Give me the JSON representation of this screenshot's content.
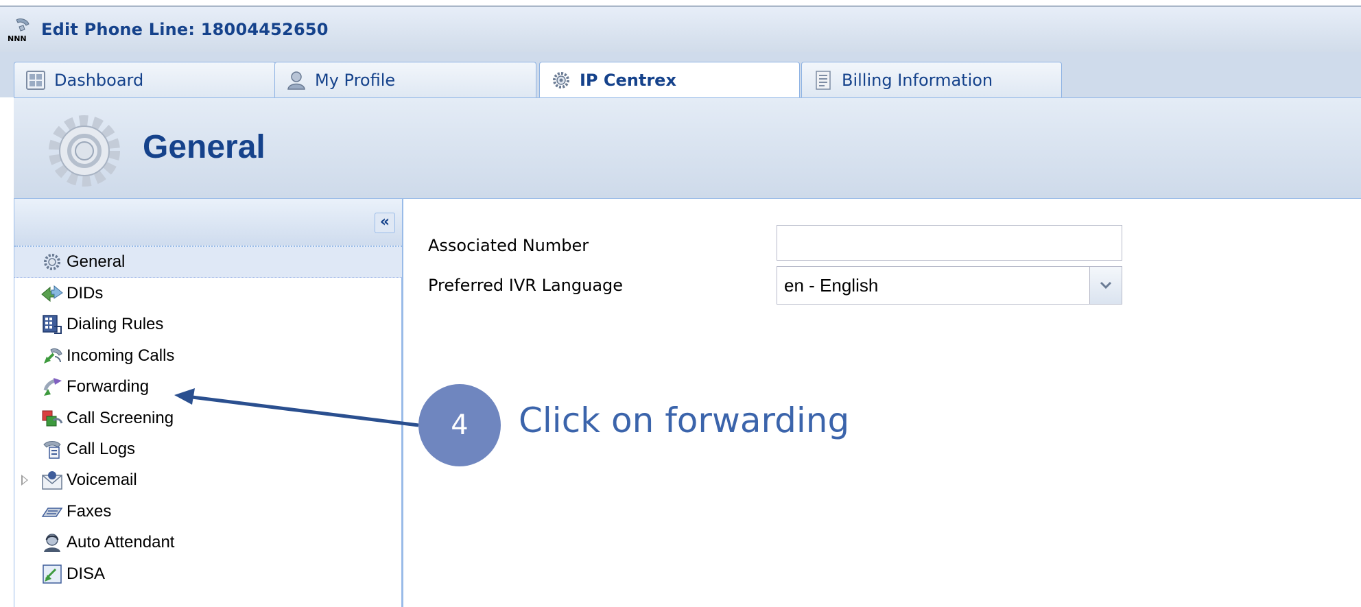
{
  "window": {
    "title": "Edit Phone Line: 18004452650",
    "icon": "phone-line-icon"
  },
  "tabs": [
    {
      "label": "Dashboard",
      "icon": "dashboard-icon",
      "active": false
    },
    {
      "label": "My Profile",
      "icon": "profile-icon",
      "active": false
    },
    {
      "label": "IP Centrex",
      "icon": "gear-icon",
      "active": true
    },
    {
      "label": "Billing Information",
      "icon": "billing-icon",
      "active": false
    }
  ],
  "header": {
    "title": "General",
    "icon": "gear-icon"
  },
  "sidebar": {
    "collapse_label": "«",
    "items": [
      {
        "label": "General",
        "icon": "gear-icon",
        "selected": true
      },
      {
        "label": "DIDs",
        "icon": "dids-icon"
      },
      {
        "label": "Dialing Rules",
        "icon": "dialpad-icon"
      },
      {
        "label": "Incoming Calls",
        "icon": "incoming-call-icon"
      },
      {
        "label": "Forwarding",
        "icon": "forward-icon"
      },
      {
        "label": "Call Screening",
        "icon": "screening-icon"
      },
      {
        "label": "Call Logs",
        "icon": "call-logs-icon"
      },
      {
        "label": "Voicemail",
        "icon": "voicemail-icon",
        "expandable": true
      },
      {
        "label": "Faxes",
        "icon": "fax-icon"
      },
      {
        "label": "Auto Attendant",
        "icon": "attendant-icon"
      },
      {
        "label": "DISA",
        "icon": "disa-icon"
      }
    ]
  },
  "form": {
    "associated_number_label": "Associated Number",
    "associated_number_value": "",
    "ivr_language_label": "Preferred IVR Language",
    "ivr_language_value": "en - English"
  },
  "annotation": {
    "step": "4",
    "text": "Click on forwarding"
  },
  "colors": {
    "accent": "#15428b",
    "border": "#99bbe8",
    "badge": "#6f86bf",
    "annotation_text": "#3b64ab"
  }
}
